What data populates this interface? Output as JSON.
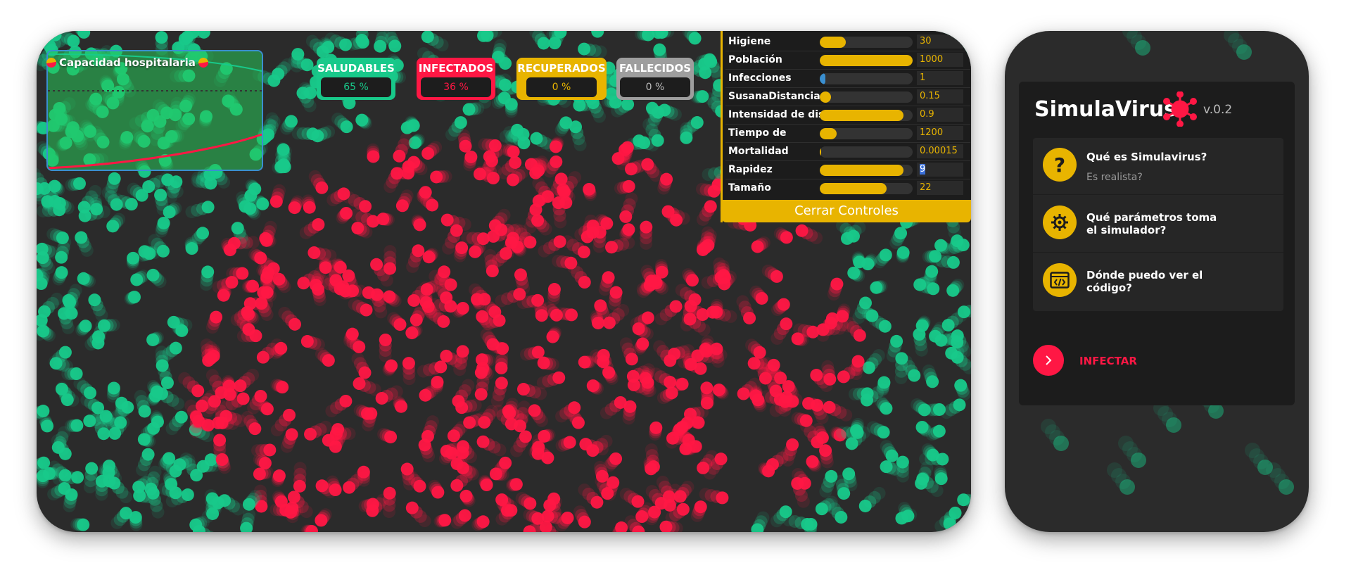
{
  "colors": {
    "healthy": "#18c98a",
    "infected": "#ff1744",
    "recovered": "#e8b400",
    "dead": "#9e9e9e",
    "accent": "#e8b400",
    "background": "#2b2b2b"
  },
  "hospital": {
    "title": "Capacidad hospitalaria",
    "icon": "pill-icon"
  },
  "stats": [
    {
      "label": "SALUDABLES",
      "value": "65 %"
    },
    {
      "label": "INFECTADOS",
      "value": "36 %"
    },
    {
      "label": "RECUPERADOS",
      "value": "0 %"
    },
    {
      "label": "FALLECIDOS",
      "value": "0 %"
    }
  ],
  "controls": [
    {
      "label": "Higiene",
      "value": "30",
      "level": 0.28
    },
    {
      "label": "Población",
      "value": "1000",
      "level": 1.0
    },
    {
      "label": "Infecciones",
      "value": "1",
      "level": 0.04
    },
    {
      "label": "SusanaDistancia",
      "value": "0.15",
      "level": 0.12
    },
    {
      "label": "Intensidad de dist.",
      "value": "0.9",
      "level": 0.9
    },
    {
      "label": "Tiempo de",
      "value": "1200",
      "level": 0.18
    },
    {
      "label": "Mortalidad",
      "value": "0.00015",
      "level": 0.0
    },
    {
      "label": "Rapidez",
      "value": "9",
      "level": 0.9
    },
    {
      "label": "Tamaño",
      "value": "22",
      "level": 0.72
    }
  ],
  "close_controls": "Cerrar Controles",
  "menu": {
    "brand": "SimulaVirus",
    "version": "v.0.2",
    "items": [
      {
        "title": "Qué es Simulavirus?",
        "subtitle": "Es realista?",
        "icon": "question-icon"
      },
      {
        "title": "Qué parámetros toma el simulador?",
        "subtitle": "",
        "icon": "gear-icon"
      },
      {
        "title": "Dónde puedo ver el código?",
        "subtitle": "",
        "icon": "code-icon"
      }
    ],
    "infect_label": "INFECTAR"
  }
}
